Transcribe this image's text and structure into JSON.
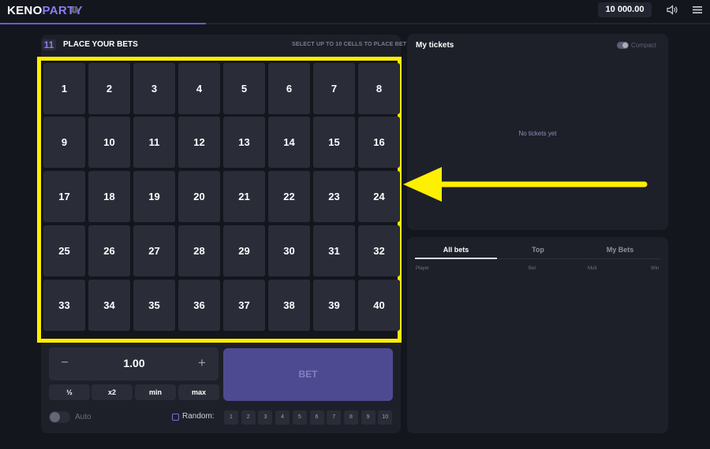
{
  "header": {
    "logo_part1": "KENO",
    "logo_part2": "PARTY",
    "info_icon": "i",
    "balance": "10 000.00",
    "sound_icon": "speaker-icon",
    "menu_icon": "hamburger-menu-icon",
    "round_progress": 0.29
  },
  "bets_panel": {
    "max_count": "11",
    "title": "PLACE YOUR BETS",
    "hint": "SELECT UP TO 10 CELLS TO PLACE BET",
    "cells": [
      "1",
      "2",
      "3",
      "4",
      "5",
      "6",
      "7",
      "8",
      "9",
      "10",
      "11",
      "12",
      "13",
      "14",
      "15",
      "16",
      "17",
      "18",
      "19",
      "20",
      "21",
      "22",
      "23",
      "24",
      "25",
      "26",
      "27",
      "28",
      "29",
      "30",
      "31",
      "32",
      "33",
      "34",
      "35",
      "36",
      "37",
      "38",
      "39",
      "40"
    ]
  },
  "controls": {
    "minus": "−",
    "amount": "1.00",
    "plus": "+",
    "quick_buttons": [
      "½",
      "x2",
      "min",
      "max"
    ],
    "bet_label": "BET",
    "auto_label": "Auto",
    "random_label": "Random:",
    "random_numbers": [
      "1",
      "2",
      "3",
      "4",
      "5",
      "6",
      "7",
      "8",
      "9",
      "10"
    ]
  },
  "tickets_panel": {
    "title": "My tickets",
    "compact_label": "Compact",
    "empty_text": "No tickets yet"
  },
  "history_panel": {
    "tabs": [
      "All bets",
      "Top",
      "My Bets"
    ],
    "active_tab": "All bets",
    "columns": [
      "Player",
      "Bet",
      "Mult",
      "Win"
    ]
  },
  "colors": {
    "highlight": "#ffef00",
    "accent": "#8b7df0",
    "bet_button": "#4e4a92"
  }
}
